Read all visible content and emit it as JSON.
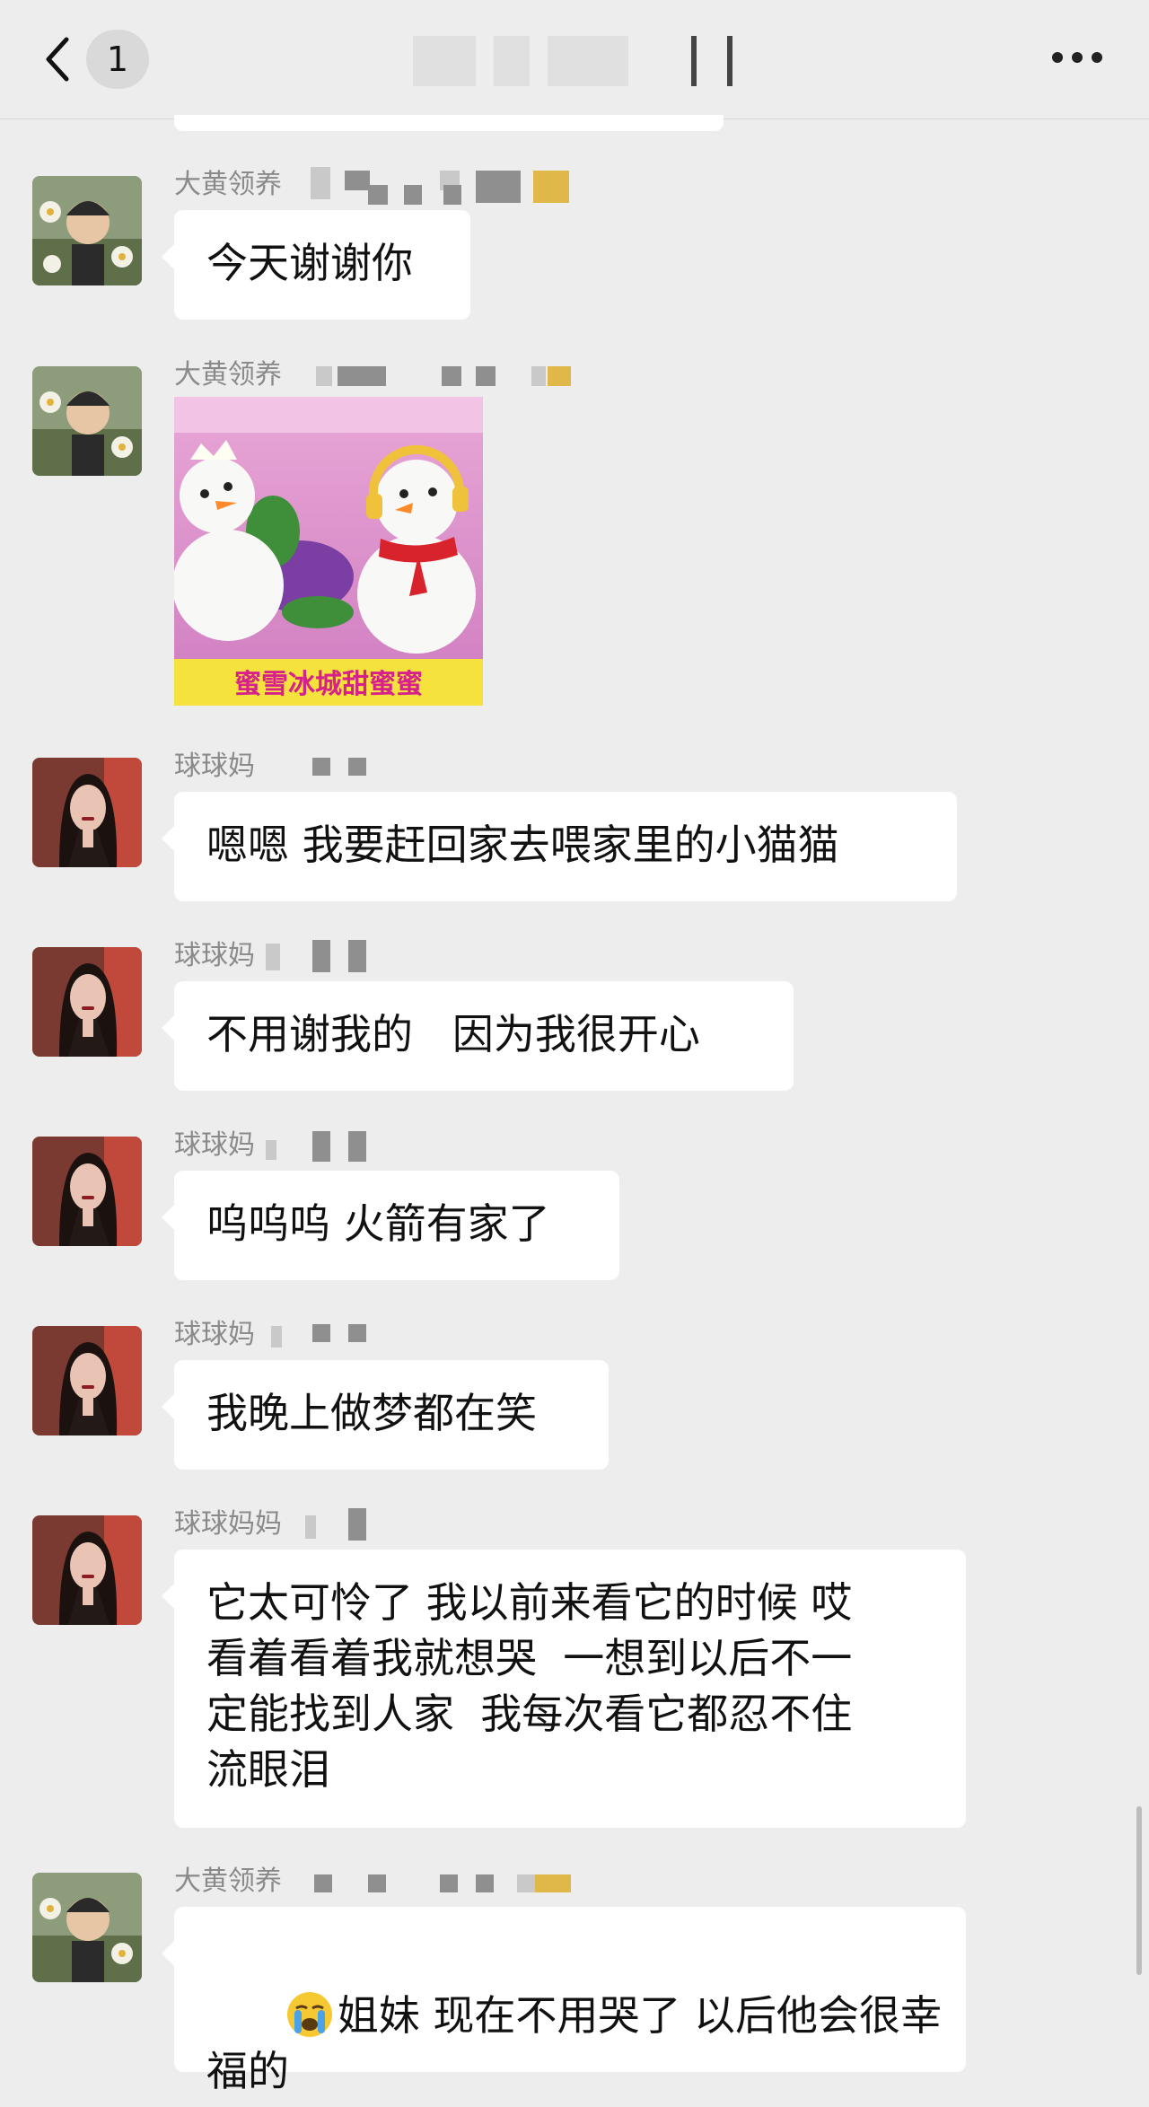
{
  "header": {
    "unread_count": "1"
  },
  "senders": {
    "dahuang": "大黄领养",
    "qiuqiu": "球球妈"
  },
  "messages": [
    {
      "sender": "大黄领养",
      "text": "今天谢谢你"
    },
    {
      "sender": "大黄领养",
      "sticker_caption": "蜜雪冰城甜蜜蜜"
    },
    {
      "sender": "球球妈",
      "text": "嗯嗯 我要赶回家去喂家里的小猫猫"
    },
    {
      "sender": "球球妈",
      "text": "不用谢我的   因为我很开心"
    },
    {
      "sender": "球球妈",
      "text": "呜呜呜 火箭有家了"
    },
    {
      "sender": "球球妈",
      "text": "我晚上做梦都在笑"
    },
    {
      "sender": "球球妈妈",
      "lines": [
        "它太可怜了 我以前来看它的时候 哎",
        "看着看着我就想哭  一想到以后不一",
        "定能找到人家  我每次看它都忍不住",
        "流眼泪"
      ]
    },
    {
      "sender": "大黄领养",
      "emoji": "crying-face",
      "lines": [
        "姐妹 现在不用哭了 以后他会很幸",
        "福的"
      ]
    }
  ],
  "colors": {
    "background": "#ededed",
    "bubble": "#ffffff",
    "sender_name": "#8a8a8a"
  }
}
